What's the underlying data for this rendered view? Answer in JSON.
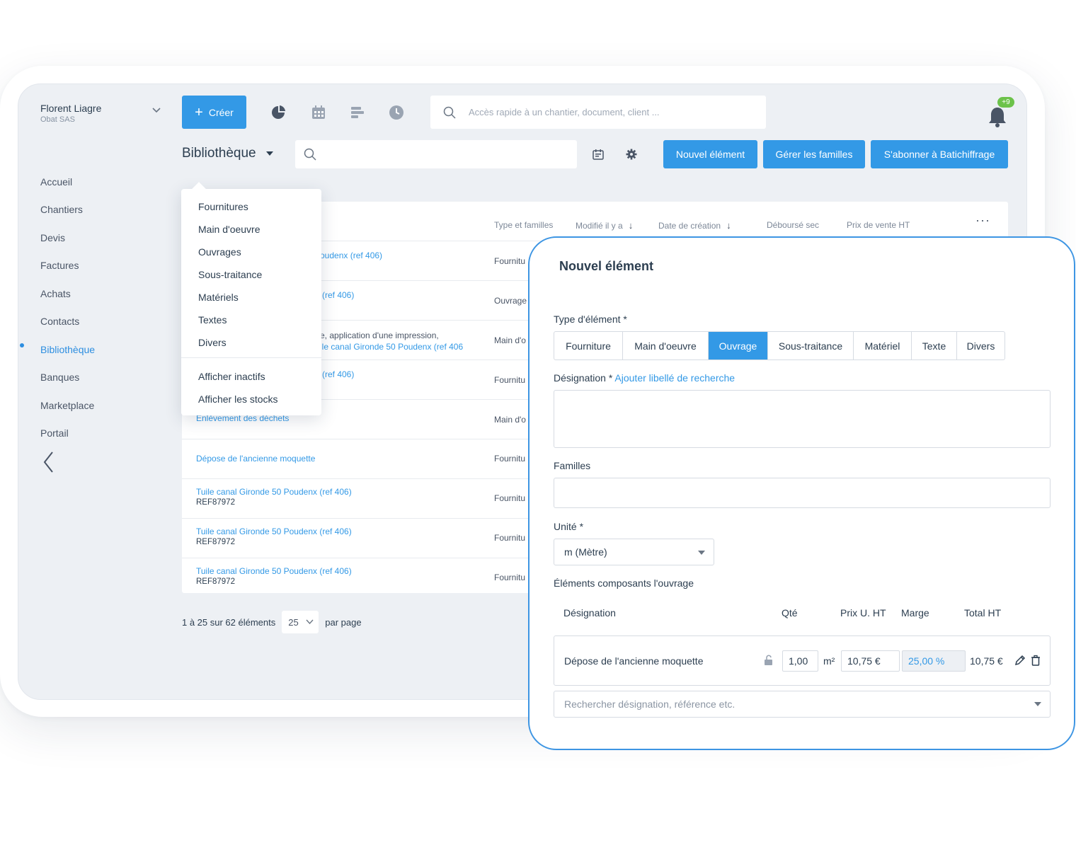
{
  "user": {
    "name": "Florent Liagre",
    "company": "Obat SAS"
  },
  "nav": {
    "items": [
      {
        "label": "Accueil"
      },
      {
        "label": "Chantiers"
      },
      {
        "label": "Devis"
      },
      {
        "label": "Factures"
      },
      {
        "label": "Achats"
      },
      {
        "label": "Contacts"
      },
      {
        "label": "Bibliothèque"
      },
      {
        "label": "Banques"
      },
      {
        "label": "Marketplace"
      },
      {
        "label": "Portail"
      }
    ],
    "active": "Bibliothèque"
  },
  "topbar": {
    "create_label": "Créer",
    "search_placeholder": "Accès rapide à un chantier, document, client ...",
    "notifications_badge": "+9"
  },
  "library": {
    "title": "Bibliothèque",
    "search_placeholder": "",
    "buttons": {
      "new_element": "Nouvel élément",
      "manage_families": "Gérer les familles",
      "subscribe": "S'abonner à Batichiffrage"
    }
  },
  "table": {
    "headers": {
      "type": "Type et familles",
      "modified": "Modifié il y a",
      "created": "Date de création",
      "cost": "Déboursé sec",
      "price": "Prix de vente HT",
      "more": "···"
    },
    "rows": [
      {
        "name": "oudenx (ref 406)",
        "ref": "",
        "type": "Fournitu"
      },
      {
        "name": "(ref 406)",
        "ref": "",
        "type": "Ouvrage"
      },
      {
        "name_line1": "e, application d'une impression,",
        "name": "ile canal Gironde 50 Poudenx (ref 406",
        "type": "Main d'o"
      },
      {
        "name": "(ref 406)",
        "ref": "",
        "type": "Fournitu"
      },
      {
        "name": "Enlèvement des déchets",
        "ref": "",
        "type": "Main d'o"
      },
      {
        "name": "Dépose de l'ancienne moquette",
        "ref": "",
        "type": "Fournitu"
      },
      {
        "name": "Tuile canal Gironde 50 Poudenx (ref 406)",
        "ref": "REF87972",
        "type": "Fournitu"
      },
      {
        "name": "Tuile canal Gironde 50 Poudenx (ref 406)",
        "ref": "REF87972",
        "type": "Fournitu"
      },
      {
        "name": "Tuile canal Gironde 50 Poudenx (ref 406)",
        "ref": "REF87972",
        "type": "Fournitu"
      }
    ]
  },
  "pager": {
    "range": "1 à 25 sur 62 éléments",
    "per_page_value": "25",
    "per_page_label": "par page"
  },
  "menu": {
    "items": [
      {
        "label": "Fournitures"
      },
      {
        "label": "Main d'oeuvre"
      },
      {
        "label": "Ouvrages"
      },
      {
        "label": "Sous-traitance"
      },
      {
        "label": "Matériels"
      },
      {
        "label": "Textes"
      },
      {
        "label": "Divers"
      }
    ],
    "extra": [
      {
        "label": "Afficher inactifs"
      },
      {
        "label": "Afficher les stocks"
      }
    ]
  },
  "modal": {
    "title": "Nouvel élément",
    "type_label": "Type d'élément *",
    "types": [
      "Fourniture",
      "Main d'oeuvre",
      "Ouvrage",
      "Sous-traitance",
      "Matériel",
      "Texte",
      "Divers"
    ],
    "active_type": "Ouvrage",
    "designation_label": "Désignation",
    "designation_required": " *",
    "add_search_label": "Ajouter libellé de recherche",
    "designation_value": "",
    "families_label": "Familles",
    "families_value": "",
    "unit_label": "Unité *",
    "unit_value": "m (Mètre)",
    "components_label": "Éléments composants l'ouvrage",
    "components_headers": {
      "designation": "Désignation",
      "qty": "Qté",
      "unit_price": "Prix U. HT",
      "margin": "Marge",
      "total": "Total HT"
    },
    "component": {
      "name": "Dépose de l'ancienne moquette",
      "qty": "1,00",
      "unit": "m²",
      "unit_price": "10,75 €",
      "margin": "25,00 %",
      "total": "10,75 €"
    },
    "search_placeholder": "Rechercher désignation, référence etc."
  },
  "colors": {
    "accent": "#3399e6",
    "badge": "#6cc24a",
    "background": "#edf0f4"
  }
}
